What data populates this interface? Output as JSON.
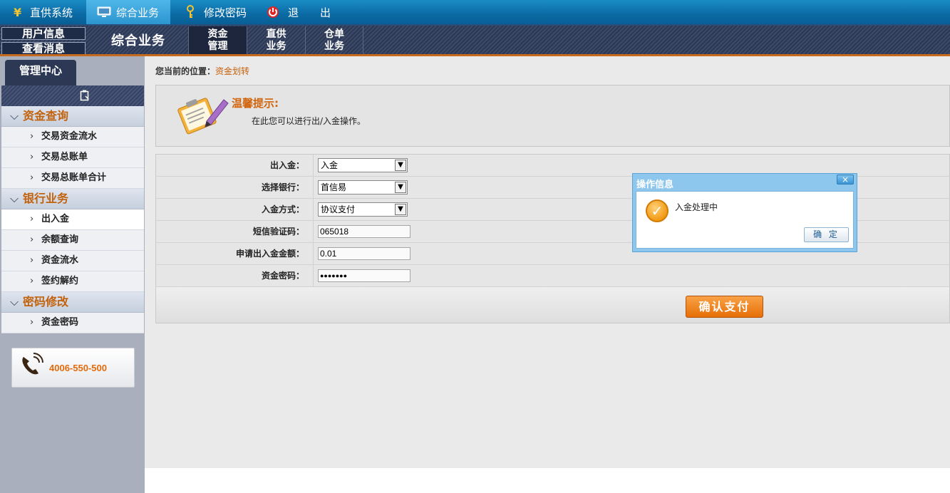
{
  "topbar": {
    "items": [
      {
        "label": "直供系统",
        "icon": "yen-icon"
      },
      {
        "label": "综合业务",
        "icon": "computer-icon"
      },
      {
        "label": "修改密码",
        "icon": "key-icon"
      },
      {
        "label": "退　　出",
        "icon": "power-icon"
      }
    ]
  },
  "header": {
    "user_info": "用户信息",
    "view_messages": "查看消息",
    "section_title": "综合业务",
    "tabs": [
      {
        "line1": "资金",
        "line2": "管理"
      },
      {
        "line1": "直供",
        "line2": "业务"
      },
      {
        "line1": "仓单",
        "line2": "业务"
      }
    ]
  },
  "sidebar": {
    "tab_label": "管理中心",
    "groups": [
      {
        "label": "资金查询",
        "items": [
          "交易资金流水",
          "交易总账单",
          "交易总账单合计"
        ]
      },
      {
        "label": "银行业务",
        "items": [
          "出入金",
          "余额查询",
          "资金流水",
          "签约解约"
        ]
      },
      {
        "label": "密码修改",
        "items": [
          "资金密码"
        ]
      }
    ],
    "active_item": "出入金",
    "hotline": "4006-550-500"
  },
  "main": {
    "location_label": "您当前的位置：",
    "location_value": "资金划转",
    "tip_title": "温馨提示:",
    "tip_text": "在此您可以进行出/入金操作。",
    "form": {
      "direction_label": "出入金：",
      "direction_value": "入金",
      "bank_label": "选择银行：",
      "bank_value": "首信易",
      "method_label": "入金方式：",
      "method_value": "协议支付",
      "sms_label": "短信验证码：",
      "sms_value": "065018",
      "amount_label": "申请出入金金额：",
      "amount_value": "0.01",
      "password_label": "资金密码：",
      "password_value": "●●●●●●●"
    },
    "confirm_button": "确认支付"
  },
  "dialog": {
    "title": "操作信息",
    "close": "×",
    "message": "入金处理中",
    "ok_button": "确 定"
  },
  "colors": {
    "accent_orange": "#e66f06",
    "top_blue": "#0b6aa4",
    "nav_dark": "#2c3854"
  }
}
